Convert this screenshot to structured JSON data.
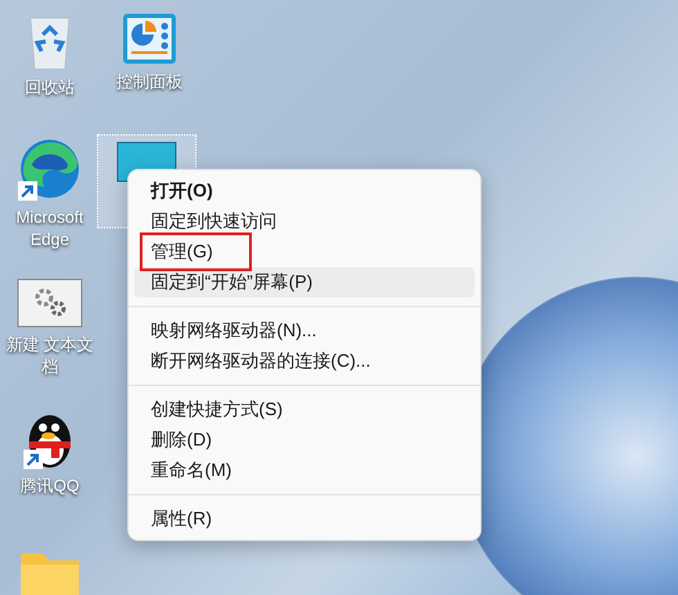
{
  "desktop_icons": [
    {
      "kind": "recycle-bin",
      "label": "回收站",
      "shortcut": false,
      "selected": false
    },
    {
      "kind": "control-panel",
      "label": "控制面板",
      "shortcut": false,
      "selected": false
    },
    {
      "kind": "edge",
      "label": "Microsoft Edge",
      "shortcut": true,
      "selected": false
    },
    {
      "kind": "monitor",
      "shortcut": false,
      "selected": true
    },
    {
      "kind": "gear-file",
      "label": "新建 文本文档",
      "shortcut": false,
      "selected": false
    },
    {
      "kind": "penguin",
      "label": "腾讯QQ",
      "shortcut": true,
      "selected": false
    },
    {
      "kind": "folder",
      "shortcut": false,
      "selected": false
    }
  ],
  "context_menu": {
    "groups": [
      [
        {
          "label": "打开(O)",
          "bold": true,
          "selected": false,
          "annotated": false
        },
        {
          "label": "固定到快速访问",
          "bold": false,
          "selected": false,
          "annotated": false
        },
        {
          "label": "管理(G)",
          "bold": false,
          "selected": false,
          "annotated": true
        },
        {
          "label": "固定到“开始”屏幕(P)",
          "bold": false,
          "selected": true,
          "annotated": false
        }
      ],
      [
        {
          "label": "映射网络驱动器(N)...",
          "bold": false,
          "selected": false,
          "annotated": false
        },
        {
          "label": "断开网络驱动器的连接(C)...",
          "bold": false,
          "selected": false,
          "annotated": false
        }
      ],
      [
        {
          "label": "创建快捷方式(S)",
          "bold": false,
          "selected": false,
          "annotated": false
        },
        {
          "label": "删除(D)",
          "bold": false,
          "selected": false,
          "annotated": false
        },
        {
          "label": "重命名(M)",
          "bold": false,
          "selected": false,
          "annotated": false
        }
      ],
      [
        {
          "label": "属性(R)",
          "bold": false,
          "selected": false,
          "annotated": false
        }
      ]
    ]
  }
}
